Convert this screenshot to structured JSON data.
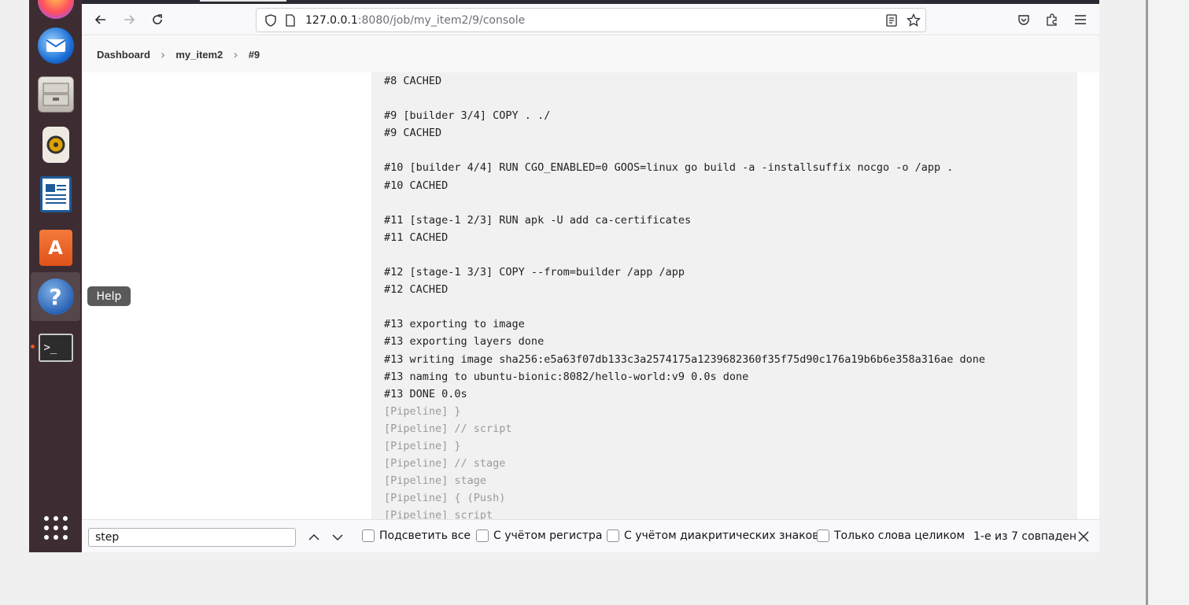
{
  "dock": {
    "items": [
      {
        "name": "firefox"
      },
      {
        "name": "thunderbird"
      },
      {
        "name": "files"
      },
      {
        "name": "rhythmbox"
      },
      {
        "name": "libreoffice-writer"
      },
      {
        "name": "ubuntu-software"
      },
      {
        "name": "help"
      },
      {
        "name": "terminal"
      }
    ],
    "tooltip": "Help"
  },
  "browser": {
    "url_host": "127.0.0.1",
    "url_rest": ":8080/job/my_item2/9/console"
  },
  "breadcrumbs": [
    "Dashboard",
    "my_item2",
    "#9"
  ],
  "console": {
    "lines": [
      {
        "text": "#8 CACHED",
        "dim": false
      },
      {
        "text": "",
        "dim": false
      },
      {
        "text": "#9 [builder 3/4] COPY . ./",
        "dim": false
      },
      {
        "text": "#9 CACHED",
        "dim": false
      },
      {
        "text": "",
        "dim": false
      },
      {
        "text": "#10 [builder 4/4] RUN CGO_ENABLED=0 GOOS=linux go build -a -installsuffix nocgo -o /app .",
        "dim": false
      },
      {
        "text": "#10 CACHED",
        "dim": false
      },
      {
        "text": "",
        "dim": false
      },
      {
        "text": "#11 [stage-1 2/3] RUN apk -U add ca-certificates",
        "dim": false
      },
      {
        "text": "#11 CACHED",
        "dim": false
      },
      {
        "text": "",
        "dim": false
      },
      {
        "text": "#12 [stage-1 3/3] COPY --from=builder /app /app",
        "dim": false
      },
      {
        "text": "#12 CACHED",
        "dim": false
      },
      {
        "text": "",
        "dim": false
      },
      {
        "text": "#13 exporting to image",
        "dim": false
      },
      {
        "text": "#13 exporting layers done",
        "dim": false
      },
      {
        "text": "#13 writing image sha256:e5a63f07db133c3a2574175a1239682360f35f75d90c176a19b6b6e358a316ae done",
        "dim": false
      },
      {
        "text": "#13 naming to ubuntu-bionic:8082/hello-world:v9 0.0s done",
        "dim": false
      },
      {
        "text": "#13 DONE 0.0s",
        "dim": false
      },
      {
        "text": "[Pipeline] }",
        "dim": true
      },
      {
        "text": "[Pipeline] // script",
        "dim": true
      },
      {
        "text": "[Pipeline] }",
        "dim": true
      },
      {
        "text": "[Pipeline] // stage",
        "dim": true
      },
      {
        "text": "[Pipeline] stage",
        "dim": true
      },
      {
        "text": "[Pipeline] { (Push)",
        "dim": true
      },
      {
        "text": "[Pipeline] script",
        "dim": true
      }
    ]
  },
  "findbar": {
    "query": "step",
    "highlight_all": "Подсветить все",
    "match_case": "С учётом регистра",
    "match_diacritics": "С учётом диакритических знаков",
    "whole_words": "Только слова целиком",
    "status": "1-е из 7 совпаден"
  },
  "colors": {
    "dock_bg": "#3d2d33",
    "running_indicator": "#e95420",
    "console_bg": "#f1f1f1"
  }
}
